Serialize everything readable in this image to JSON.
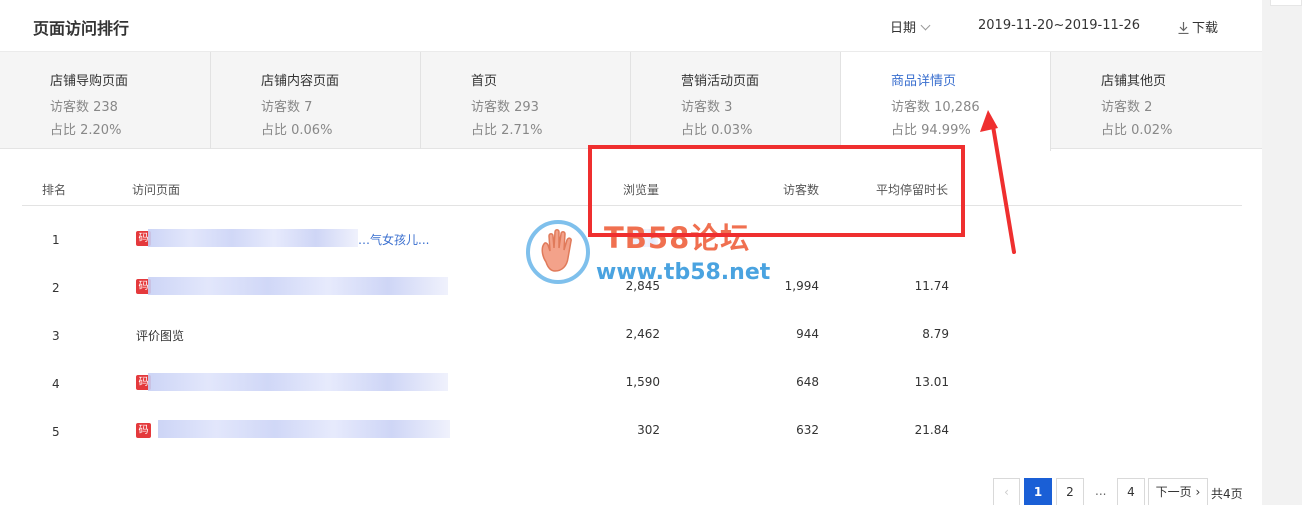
{
  "header": {
    "title": "页面访问排行",
    "date_label": "日期",
    "date_range": "2019-11-20~2019-11-26",
    "download_label": "下载"
  },
  "tabs": [
    {
      "name": "店铺导购页面",
      "visitors": "访客数 238",
      "ratio": "占比 2.20%",
      "active": false
    },
    {
      "name": "店铺内容页面",
      "visitors": "访客数 7",
      "ratio": "占比 0.06%",
      "active": false
    },
    {
      "name": "首页",
      "visitors": "访客数 293",
      "ratio": "占比 2.71%",
      "active": false
    },
    {
      "name": "营销活动页面",
      "visitors": "访客数 3",
      "ratio": "占比 0.03%",
      "active": false
    },
    {
      "name": "商品详情页",
      "visitors": "访客数 10,286",
      "ratio": "占比 94.99%",
      "active": true
    },
    {
      "name": "店铺其他页",
      "visitors": "访客数 2",
      "ratio": "占比 0.02%",
      "active": false
    }
  ],
  "table": {
    "columns": [
      "排名",
      "访问页面",
      "浏览量",
      "访客数",
      "平均停留时长"
    ],
    "rows": [
      {
        "rank": "1",
        "badge": "码",
        "page": "…气女孩儿...",
        "views": "",
        "visitors": "",
        "avg_stay": ""
      },
      {
        "rank": "2",
        "badge": "码",
        "page": "",
        "views": "2,845",
        "visitors": "1,994",
        "avg_stay": "11.74"
      },
      {
        "rank": "3",
        "badge": "",
        "page": "评价图览",
        "views": "2,462",
        "visitors": "944",
        "avg_stay": "8.79"
      },
      {
        "rank": "4",
        "badge": "码",
        "page": "",
        "views": "1,590",
        "visitors": "648",
        "avg_stay": "13.01"
      },
      {
        "rank": "5",
        "badge": "码",
        "page": "",
        "views": "302",
        "visitors": "632",
        "avg_stay": "21.84"
      }
    ]
  },
  "watermark": {
    "name": "TB58论坛",
    "url": "www.tb58.net"
  },
  "pagination": {
    "prev": "‹",
    "pages": [
      "1",
      "2",
      "...",
      "4"
    ],
    "current": "1",
    "next": "下一页",
    "total": "共4页"
  },
  "colors": {
    "accent": "#1a5fd6",
    "link": "#3a6fcf",
    "annotation": "#ef2f2f"
  }
}
